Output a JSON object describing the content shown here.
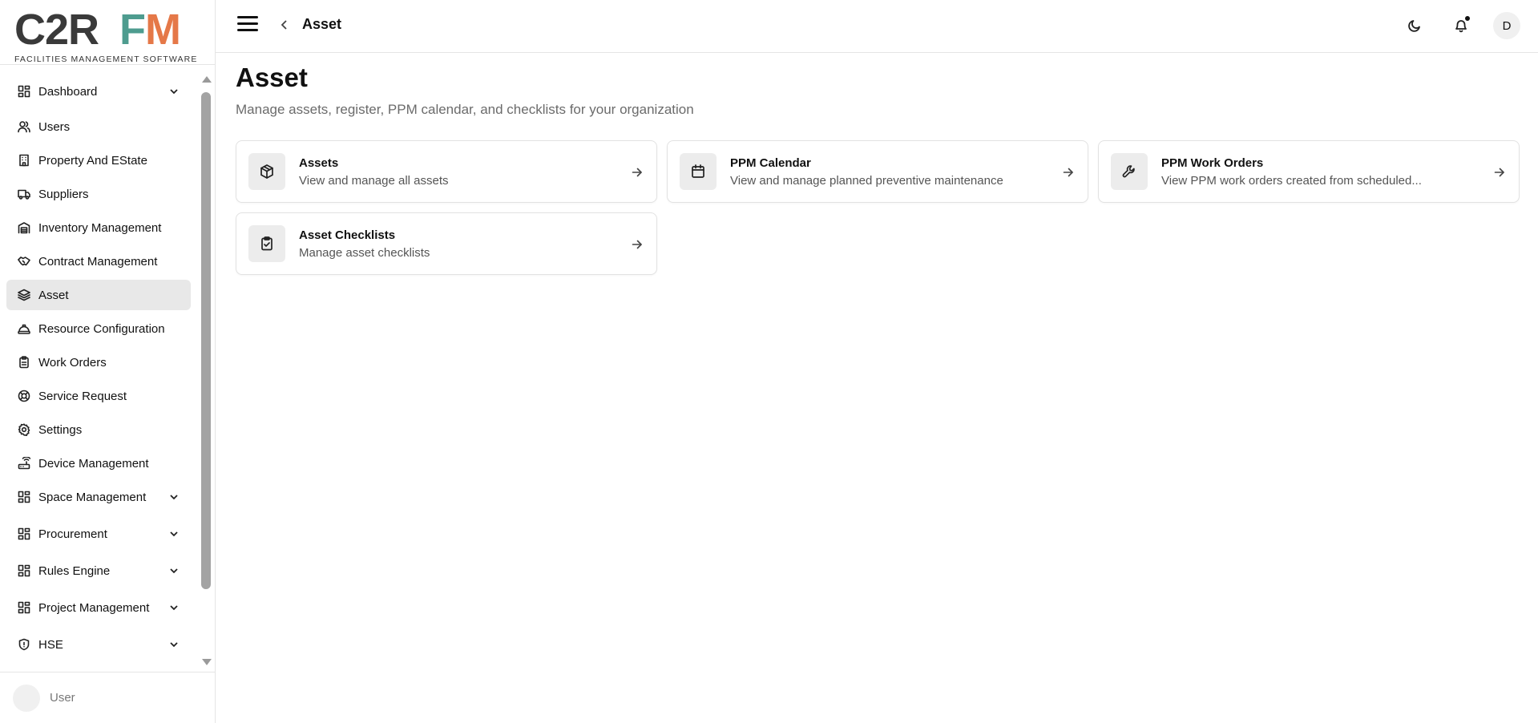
{
  "brand": {
    "logo_c2r": "C2R",
    "logo_f": "F",
    "logo_m": "M",
    "tagline": "FACILITIES MANAGEMENT SOFTWARE",
    "colors": {
      "teal": "#4e9c8f",
      "orange": "#e57848",
      "dark": "#3a3a3a"
    }
  },
  "sidebar": {
    "items": [
      {
        "label": "Dashboard",
        "icon": "dashboard-icon",
        "expandable": true
      },
      {
        "label": "Users",
        "icon": "users-icon",
        "expandable": false
      },
      {
        "label": "Property And EState",
        "icon": "building-icon",
        "expandable": false
      },
      {
        "label": "Suppliers",
        "icon": "truck-icon",
        "expandable": false
      },
      {
        "label": "Inventory Management",
        "icon": "warehouse-icon",
        "expandable": false
      },
      {
        "label": "Contract Management",
        "icon": "handshake-icon",
        "expandable": false
      },
      {
        "label": "Asset",
        "icon": "layers-icon",
        "expandable": false,
        "active": true
      },
      {
        "label": "Resource Configuration",
        "icon": "hard-hat-icon",
        "expandable": false
      },
      {
        "label": "Work Orders",
        "icon": "clipboard-icon",
        "expandable": false
      },
      {
        "label": "Service Request",
        "icon": "lifebuoy-icon",
        "expandable": false
      },
      {
        "label": "Settings",
        "icon": "gear-icon",
        "expandable": false
      },
      {
        "label": "Device Management",
        "icon": "router-icon",
        "expandable": false
      },
      {
        "label": "Space Management",
        "icon": "dashboard-icon",
        "expandable": true
      },
      {
        "label": "Procurement",
        "icon": "dashboard-icon",
        "expandable": true
      },
      {
        "label": "Rules Engine",
        "icon": "dashboard-icon",
        "expandable": true
      },
      {
        "label": "Project Management",
        "icon": "dashboard-icon",
        "expandable": true
      },
      {
        "label": "HSE",
        "icon": "shield-icon",
        "expandable": true
      }
    ],
    "user_label": "User"
  },
  "header": {
    "title": "Asset",
    "avatar_initial": "D"
  },
  "main": {
    "title": "Asset",
    "subtitle": "Manage assets, register, PPM calendar, and checklists for your organization",
    "cards": [
      {
        "title": "Assets",
        "description": "View and manage all assets",
        "icon": "box-icon"
      },
      {
        "title": "PPM Calendar",
        "description": "View and manage planned preventive maintenance",
        "icon": "calendar-icon"
      },
      {
        "title": "PPM Work Orders",
        "description": "View PPM work orders created from scheduled...",
        "icon": "wrench-icon"
      },
      {
        "title": "Asset Checklists",
        "description": "Manage asset checklists",
        "icon": "clipboard-check-icon"
      }
    ]
  }
}
